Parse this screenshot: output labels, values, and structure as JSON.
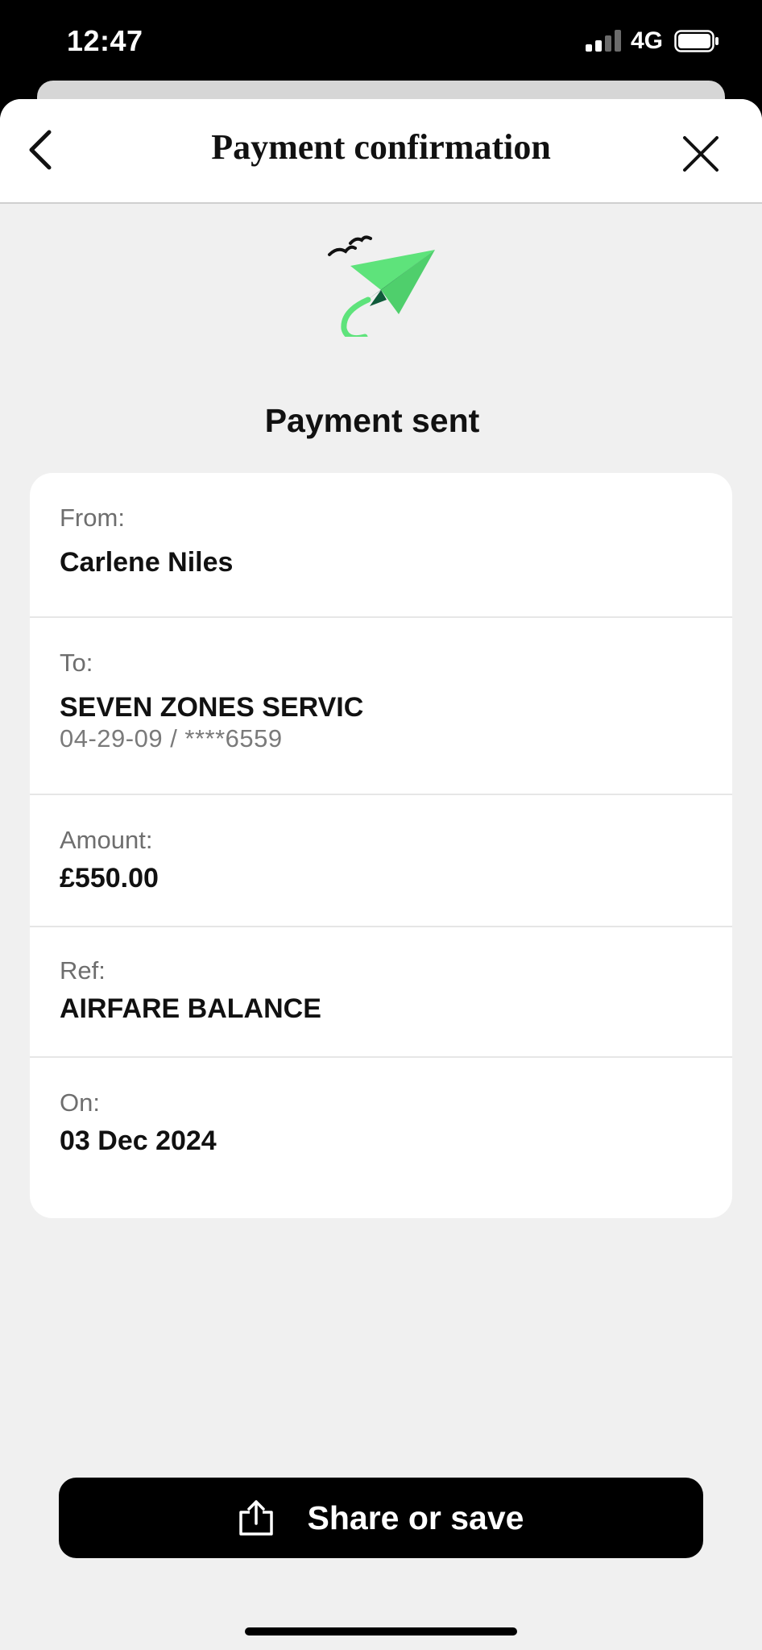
{
  "status_bar": {
    "time": "12:47",
    "network": "4G",
    "signal_bars_active": 2,
    "signal_bars_total": 4,
    "battery_level": 0.9
  },
  "header": {
    "title": "Payment confirmation",
    "back_icon": "chevron-left-icon",
    "close_icon": "close-icon"
  },
  "hero": {
    "icon": "paper-plane-with-birds-icon",
    "title": "Payment sent"
  },
  "details": {
    "from": {
      "label": "From:",
      "value": "Carlene Niles"
    },
    "to": {
      "label": "To:",
      "value": "SEVEN ZONES SERVIC",
      "account": "04-29-09 / ****6559"
    },
    "amount": {
      "label": "Amount:",
      "value": "£550.00"
    },
    "ref": {
      "label": "Ref:",
      "value": "AIRFARE BALANCE"
    },
    "on": {
      "label": "On:",
      "value": "03 Dec 2024"
    }
  },
  "actions": {
    "share_label": "Share or save",
    "share_icon": "share-upload-icon"
  },
  "colors": {
    "accent_green": "#5ee37b",
    "dark_green": "#0f5a3a",
    "button_bg": "#000000",
    "page_bg": "#f0f0f0"
  }
}
